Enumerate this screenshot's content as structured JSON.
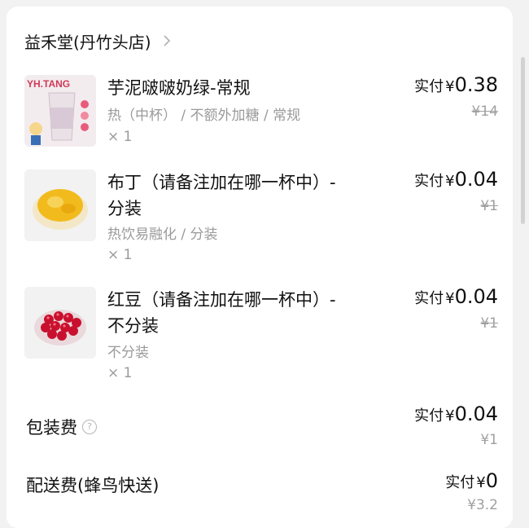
{
  "store": {
    "name": "益禾堂(丹竹头店)"
  },
  "items": [
    {
      "name": "芋泥啵啵奶绿-常规",
      "spec": "热（中杯） / 不额外加糖 / 常规",
      "qty": "× 1",
      "paid_label": "实付",
      "currency": "¥",
      "paid_amount": "0.38",
      "original_price": "¥14",
      "thumb_logo": "YH.TANG"
    },
    {
      "name_line1": "布丁（请备注加在哪一杯中）-",
      "name_line2": "分装",
      "spec": "热饮易融化 / 分装",
      "qty": "× 1",
      "paid_label": "实付",
      "currency": "¥",
      "paid_amount": "0.04",
      "original_price": "¥1"
    },
    {
      "name_line1": "红豆（请备注加在哪一杯中）-",
      "name_line2": "不分装",
      "spec": "不分装",
      "qty": "× 1",
      "paid_label": "实付",
      "currency": "¥",
      "paid_amount": "0.04",
      "original_price": "¥1"
    }
  ],
  "packaging": {
    "label": "包装费",
    "paid_label": "实付",
    "currency": "¥",
    "paid_amount": "0.04",
    "original_price": "¥1"
  },
  "delivery": {
    "label": "配送费(蜂鸟快送)",
    "paid_label": "实付",
    "currency": "¥",
    "paid_amount": "0",
    "original_price": "¥3.2"
  },
  "icons": {
    "store_chevron": "chevron-right-icon",
    "packaging_help": "help-circle-icon"
  }
}
